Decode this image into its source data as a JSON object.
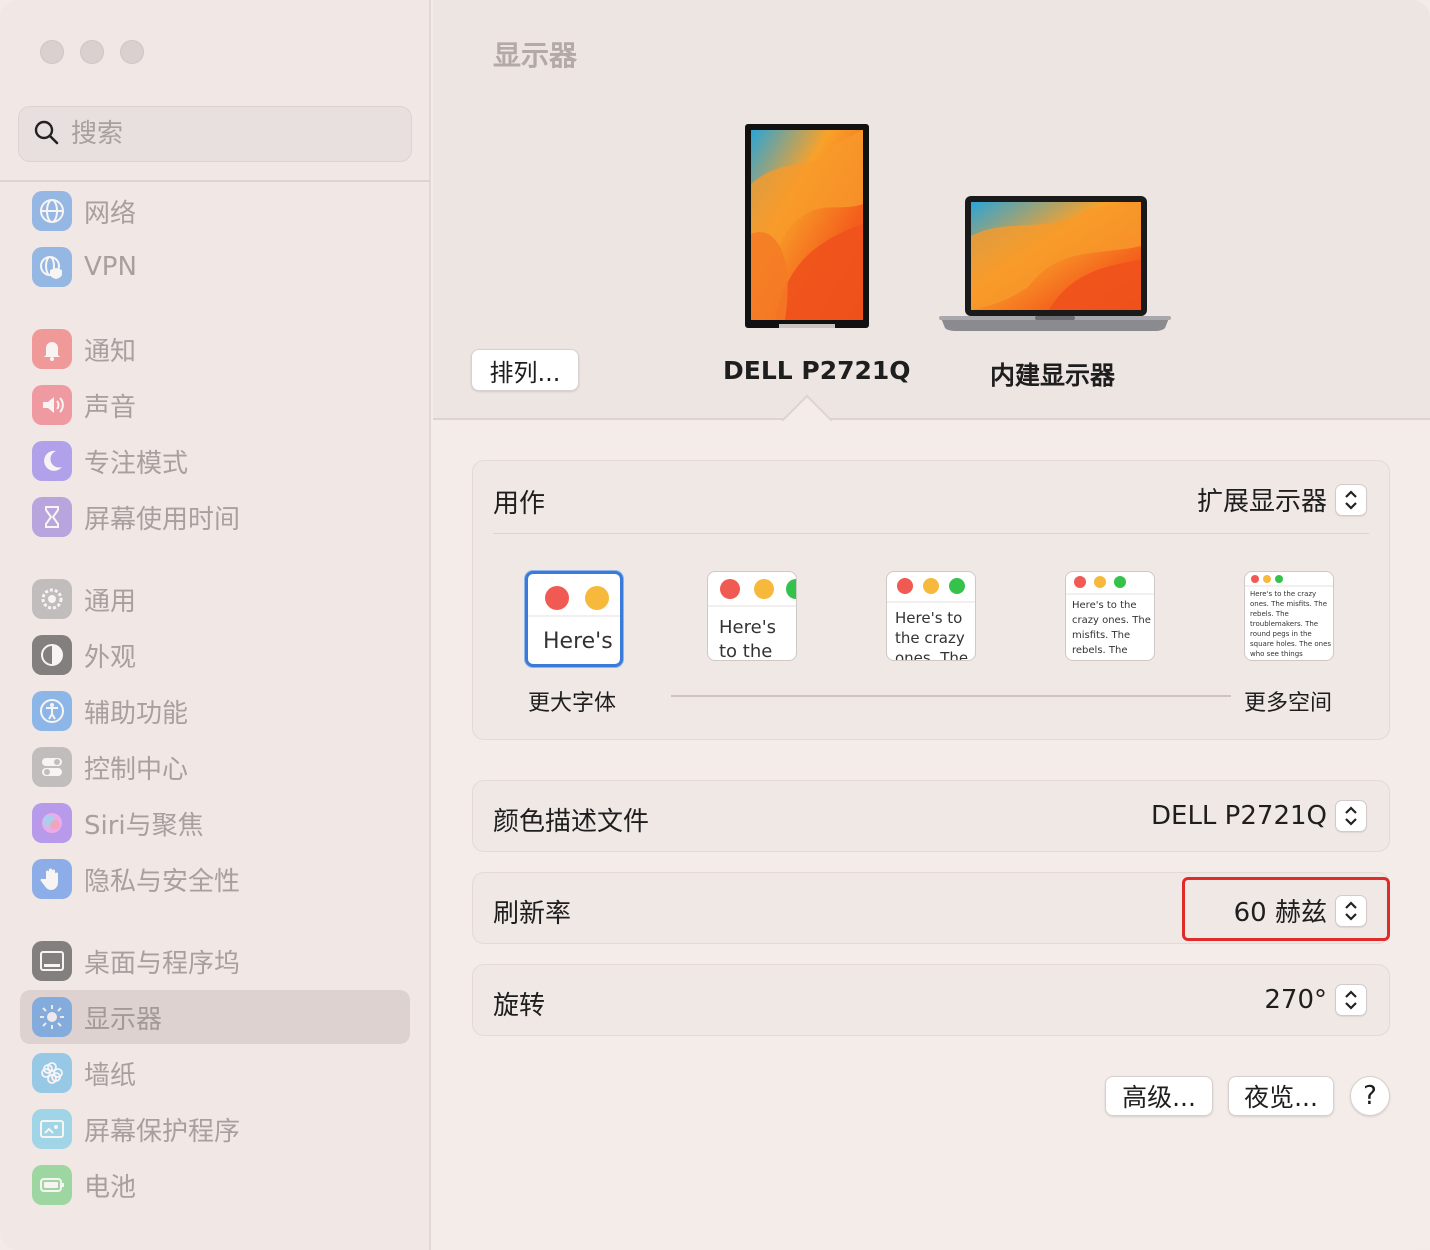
{
  "search": {
    "placeholder": "搜索"
  },
  "sidebar": {
    "items": [
      {
        "label": "网络",
        "icon": "network-globe-icon",
        "color": "#4a90e2"
      },
      {
        "label": "VPN",
        "icon": "vpn-globe-shield-icon",
        "color": "#4a90e2"
      },
      {
        "label": "通知",
        "icon": "bell-icon",
        "color": "#ef5c5c"
      },
      {
        "label": "声音",
        "icon": "speaker-icon",
        "color": "#ef5c6a"
      },
      {
        "label": "专注模式",
        "icon": "moon-icon",
        "color": "#7b68ee"
      },
      {
        "label": "屏幕使用时间",
        "icon": "hourglass-icon",
        "color": "#8d6fd8"
      },
      {
        "label": "通用",
        "icon": "gear-icon",
        "color": "#9b9b9b"
      },
      {
        "label": "外观",
        "icon": "appearance-icon",
        "color": "#2a2a2a"
      },
      {
        "label": "辅助功能",
        "icon": "accessibility-icon",
        "color": "#3b8ee8"
      },
      {
        "label": "控制中心",
        "icon": "toggles-icon",
        "color": "#9b9b9b"
      },
      {
        "label": "Siri与聚焦",
        "icon": "siri-icon",
        "color": "#8a5cf0"
      },
      {
        "label": "隐私与安全性",
        "icon": "hand-icon",
        "color": "#3b7ee8"
      },
      {
        "label": "桌面与程序坞",
        "icon": "dock-icon",
        "color": "#2a2a2a"
      },
      {
        "label": "显示器",
        "icon": "sun-icon",
        "color": "#3b8ee8"
      },
      {
        "label": "墙纸",
        "icon": "flower-icon",
        "color": "#4fb0e8"
      },
      {
        "label": "屏幕保护程序",
        "icon": "screensaver-icon",
        "color": "#5fc4e8"
      },
      {
        "label": "电池",
        "icon": "battery-icon",
        "color": "#5cc86a"
      }
    ]
  },
  "main": {
    "title": "显示器",
    "arrange_label": "排列...",
    "displays": [
      "DELL P2721Q",
      "内建显示器"
    ],
    "use_as": {
      "label": "用作",
      "value": "扩展显示器"
    },
    "resolution": {
      "left_label": "更大字体",
      "right_label": "更多空间",
      "preview_text": "Here's to the crazy ones. The misfits. The rebels. The troublemakers. The round pegs in the square holes. The ones who see things differently. They're not fond of rules. And they have no respect for the status quo. You can quote them, disagree with them, glorify or vilify them. About the only thing you can't do is ignore them. Because they change things."
    },
    "color_profile": {
      "label": "颜色描述文件",
      "value": "DELL P2721Q"
    },
    "refresh_rate": {
      "label": "刷新率",
      "value": "60 赫兹"
    },
    "rotation": {
      "label": "旋转",
      "value": "270°"
    },
    "advanced_label": "高级...",
    "night_shift_label": "夜览...",
    "help_label": "?"
  }
}
